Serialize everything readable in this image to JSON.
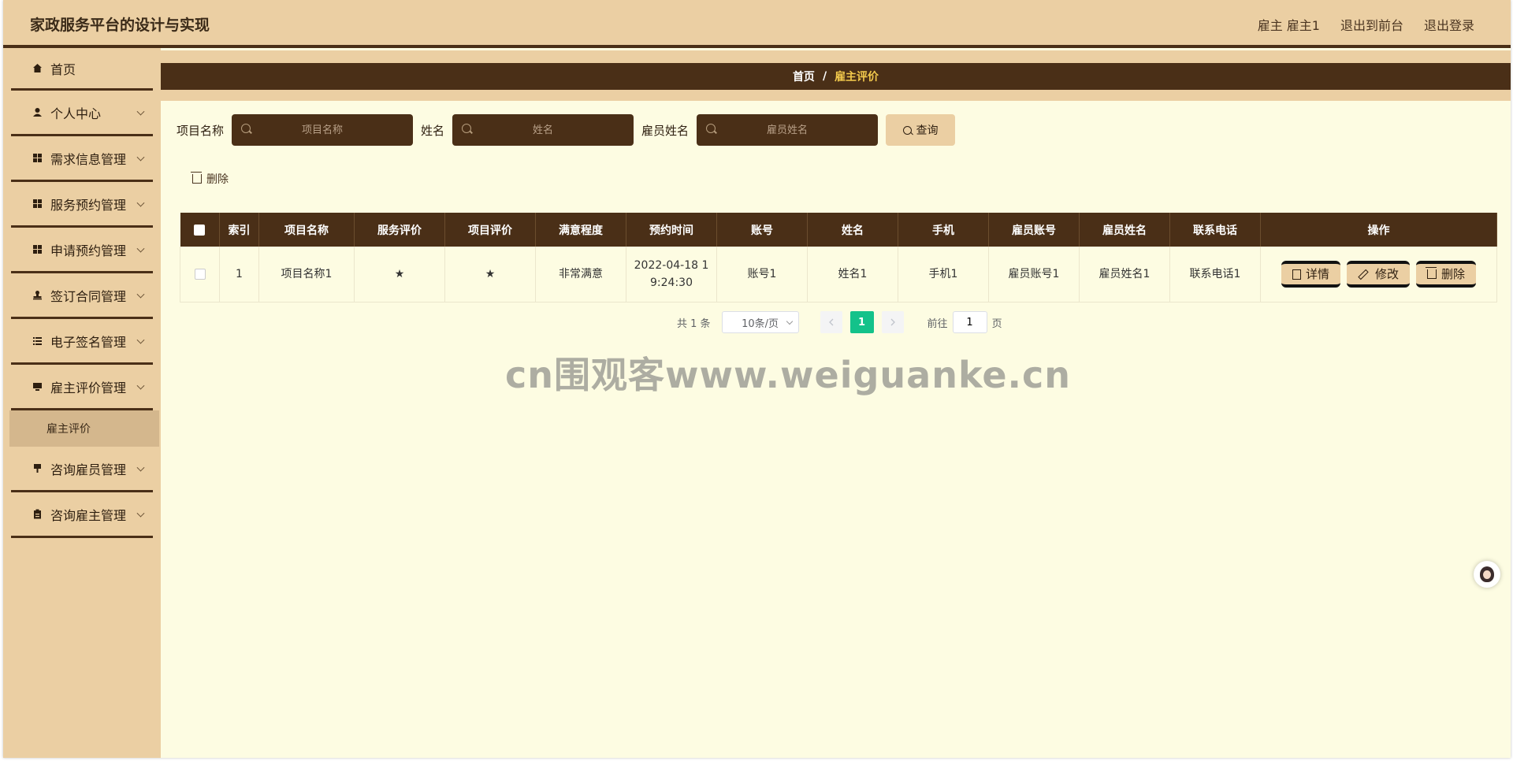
{
  "header": {
    "title": "家政服务平台的设计与实现",
    "user": "雇主 雇主1",
    "to_front": "退出到前台",
    "logout": "退出登录"
  },
  "sidebar": {
    "items": [
      {
        "label": "首页",
        "icon": "home-icon"
      },
      {
        "label": "个人中心",
        "icon": "user-icon"
      },
      {
        "label": "需求信息管理",
        "icon": "grid-icon"
      },
      {
        "label": "服务预约管理",
        "icon": "grid-icon"
      },
      {
        "label": "申请预约管理",
        "icon": "grid-icon"
      },
      {
        "label": "签订合同管理",
        "icon": "stamp-icon"
      },
      {
        "label": "电子签名管理",
        "icon": "list-icon"
      },
      {
        "label": "雇主评价管理",
        "icon": "monitor-icon"
      },
      {
        "label": "咨询雇员管理",
        "icon": "pin-icon"
      },
      {
        "label": "咨询雇主管理",
        "icon": "clipboard-icon"
      }
    ],
    "submenu": {
      "label": "雇主评价"
    }
  },
  "breadcrumb": {
    "home": "首页",
    "separator": "/",
    "current": "雇主评价"
  },
  "search": {
    "project_label": "项目名称",
    "project_placeholder": "项目名称",
    "name_label": "姓名",
    "name_placeholder": "姓名",
    "employee_label": "雇员姓名",
    "employee_placeholder": "雇员姓名",
    "query_button": "查询"
  },
  "toolbar": {
    "delete_label": "删除"
  },
  "table": {
    "headers": [
      "索引",
      "项目名称",
      "服务评价",
      "项目评价",
      "满意程度",
      "预约时间",
      "账号",
      "姓名",
      "手机",
      "雇员账号",
      "雇员姓名",
      "联系电话",
      "操作"
    ],
    "rows": [
      {
        "index": "1",
        "project": "项目名称1",
        "service_rating": "★",
        "project_rating": "★",
        "satisfaction": "非常满意",
        "time": "2022-04-18 19:24:30",
        "account": "账号1",
        "name": "姓名1",
        "phone": "手机1",
        "employee_account": "雇员账号1",
        "employee_name": "雇员姓名1",
        "contact": "联系电话1",
        "actions": {
          "detail": "详情",
          "edit": "修改",
          "delete": "删除"
        }
      }
    ]
  },
  "pagination": {
    "total": "共 1 条",
    "page_size": "10条/页",
    "current_page": "1",
    "goto_label": "前往",
    "goto_value": "1",
    "page_suffix": "页"
  },
  "watermark": "cn围观客www.weiguanke.cn",
  "colors": {
    "primary": "#4a2f17",
    "accent": "#ebcfa3",
    "background": "#fdfce2",
    "active_page": "#13c28a"
  }
}
